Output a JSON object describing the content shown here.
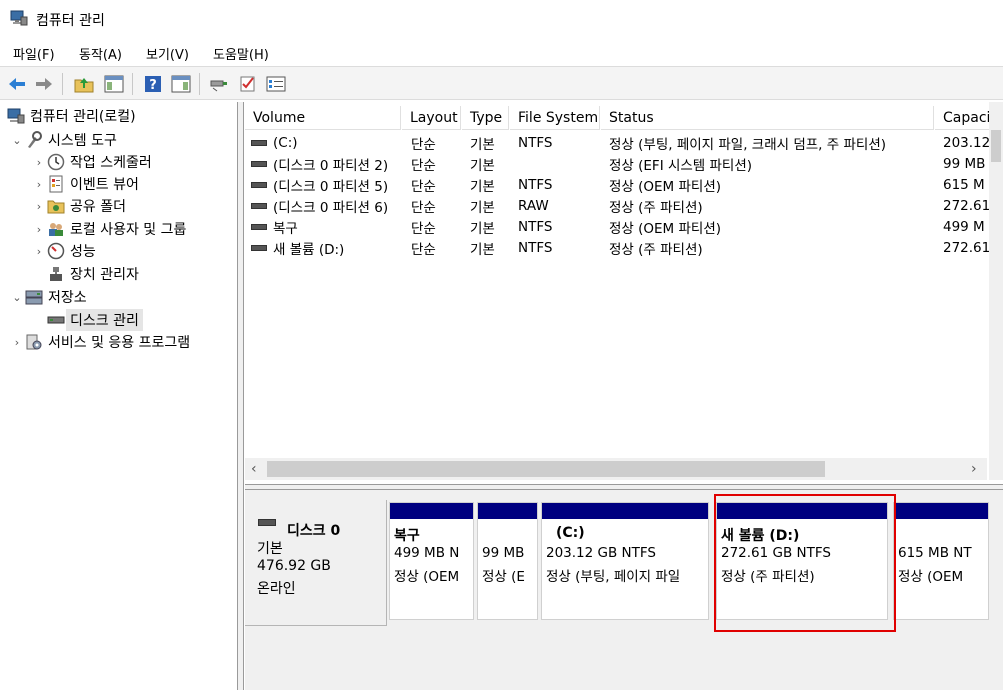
{
  "window": {
    "title": "컴퓨터 관리"
  },
  "menu": {
    "items": [
      "파일(F)",
      "동작(A)",
      "보기(V)",
      "도움말(H)"
    ]
  },
  "toolbar": {
    "buttons": [
      "back-arrow-icon",
      "forward-arrow-icon",
      "folder-up-icon",
      "show-hide-tree-icon",
      "help-icon",
      "action-pane-icon",
      "connect-icon",
      "check-icon",
      "properties-icon"
    ]
  },
  "tree": {
    "items": [
      {
        "label": "컴퓨터 관리(로컬)",
        "icon": "computer-management-icon",
        "chev": ""
      },
      {
        "label": "시스템 도구",
        "icon": "system-tools-icon",
        "chev": "⌄"
      },
      {
        "label": "작업 스케줄러",
        "icon": "clock-icon",
        "chev": "›"
      },
      {
        "label": "이벤트 뷰어",
        "icon": "event-viewer-icon",
        "chev": "›"
      },
      {
        "label": "공유 폴더",
        "icon": "shared-folder-icon",
        "chev": "›"
      },
      {
        "label": "로컬 사용자 및 그룹",
        "icon": "users-icon",
        "chev": "›"
      },
      {
        "label": "성능",
        "icon": "performance-icon",
        "chev": "›"
      },
      {
        "label": "장치 관리자",
        "icon": "device-manager-icon",
        "chev": ""
      },
      {
        "label": "저장소",
        "icon": "storage-icon",
        "chev": "⌄"
      },
      {
        "label": "디스크 관리",
        "icon": "disk-icon",
        "chev": ""
      },
      {
        "label": "서비스 및 응용 프로그램",
        "icon": "services-icon",
        "chev": "›"
      }
    ]
  },
  "volumes": {
    "headers": [
      "Volume",
      "Layout",
      "Type",
      "File System",
      "Status",
      "Capaci"
    ],
    "rows": [
      [
        "(C:)",
        "단순",
        "기본",
        "NTFS",
        "정상 (부팅, 페이지 파일, 크래시 덤프, 주 파티션)",
        "203.12"
      ],
      [
        "(디스크 0 파티션 2)",
        "단순",
        "기본",
        "",
        "정상 (EFI 시스템 파티션)",
        "99 MB"
      ],
      [
        "(디스크 0 파티션 5)",
        "단순",
        "기본",
        "NTFS",
        "정상 (OEM 파티션)",
        "615 M"
      ],
      [
        "(디스크 0 파티션 6)",
        "단순",
        "기본",
        "RAW",
        "정상 (주 파티션)",
        "272.61"
      ],
      [
        "복구",
        "단순",
        "기본",
        "NTFS",
        "정상 (OEM 파티션)",
        "499 M"
      ],
      [
        "새 볼륨 (D:)",
        "단순",
        "기본",
        "NTFS",
        "정상 (주 파티션)",
        "272.61"
      ]
    ]
  },
  "disk": {
    "name": "디스크 0",
    "type": "기본",
    "size": "476.92 GB",
    "state": "온라인",
    "partitions": [
      {
        "name": "복구",
        "line1": "499 MB N",
        "line2": "정상 (OEM"
      },
      {
        "name": "",
        "line1": "99 MB",
        "line2": "정상 (E"
      },
      {
        "name": "(C:)",
        "line1": "203.12 GB NTFS",
        "line2": "정상 (부팅, 페이지 파일"
      },
      {
        "name": "새 볼륨  (D:)",
        "line1": "272.61 GB NTFS",
        "line2": "정상 (주 파티션)"
      },
      {
        "name": "",
        "line1": "615 MB NT",
        "line2": "정상 (OEM"
      }
    ]
  },
  "colors": {
    "partition_bar": "#000080",
    "highlight": "#e00000"
  }
}
